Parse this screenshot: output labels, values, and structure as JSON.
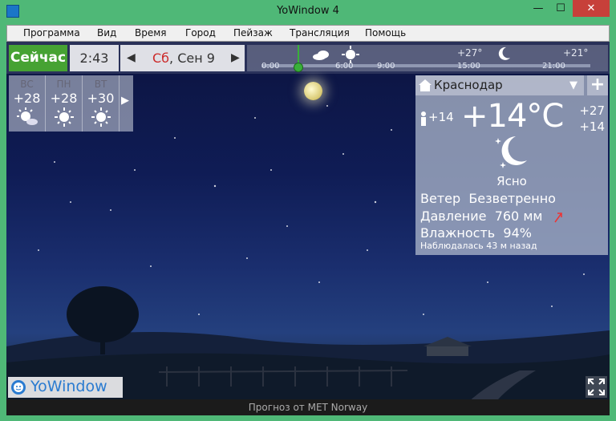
{
  "window": {
    "title": "YoWindow 4",
    "minimize": "—",
    "maximize": "☐",
    "close": "✕"
  },
  "menu": [
    {
      "label": "Программа"
    },
    {
      "label": "Вид"
    },
    {
      "label": "Время"
    },
    {
      "label": "Город"
    },
    {
      "label": "Пейзаж"
    },
    {
      "label": "Трансляция"
    },
    {
      "label": "Помощь"
    }
  ],
  "toolbar": {
    "now_label": "Сейчас",
    "time": "2:43",
    "day": "Сб",
    "date": ", Сен 9",
    "prev_icon": "chevron-left",
    "next_icon": "chevron-right"
  },
  "timeline": {
    "labels": [
      "0:00",
      "6:00",
      "9:00",
      "15:00",
      "21:00"
    ],
    "temps": [
      "+27°",
      "+21°"
    ]
  },
  "forecast": {
    "days": [
      {
        "name": "ВС",
        "temp": "+28",
        "icon": "sun-cloud",
        "weekend": true
      },
      {
        "name": "ПН",
        "temp": "+28",
        "icon": "sun",
        "weekend": false
      },
      {
        "name": "ВТ",
        "temp": "+30",
        "icon": "sun",
        "weekend": false
      }
    ],
    "more_icon": "chevron-right"
  },
  "panel": {
    "city": "Краснодар",
    "feels_like": "+14",
    "temperature": "+14°C",
    "high": "+27",
    "low": "+14",
    "condition": "Ясно",
    "wind_label": "Ветер",
    "wind_value": "Безветренно",
    "pressure_label": "Давление",
    "pressure_value": "760 мм",
    "humidity_label": "Влажность",
    "humidity_value": "94%",
    "observed": "Наблюдалась 43 м назад"
  },
  "logo": {
    "text": "YoWindow"
  },
  "footer": {
    "text": "Прогноз от MET Norway"
  },
  "colors": {
    "now": "#46a233",
    "accent": "#2a7bd0",
    "sunday": "#cc2a2a"
  }
}
